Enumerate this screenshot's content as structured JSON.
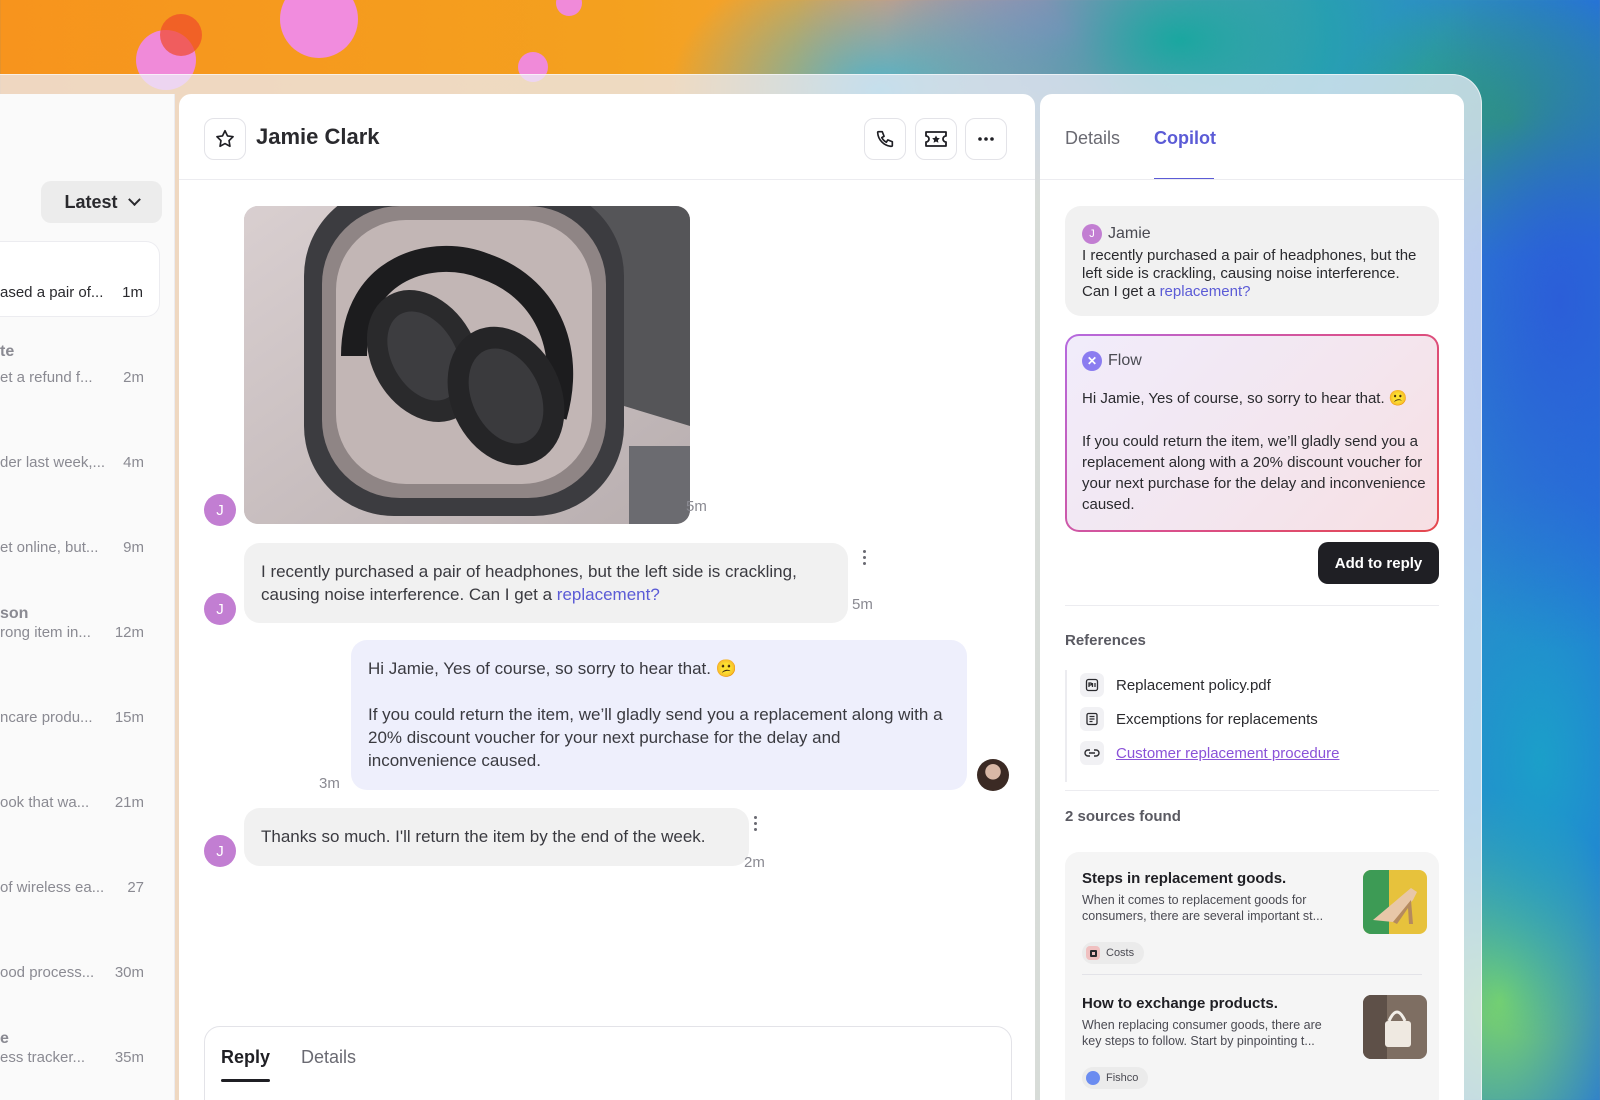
{
  "list": {
    "sort_label": "Latest",
    "items": [
      {
        "name": "",
        "preview": "ased a pair of...",
        "time": "1m",
        "active": true
      },
      {
        "name": "te",
        "preview": "et  a refund f...",
        "time": "2m"
      },
      {
        "name": "",
        "preview": "der last week,...",
        "time": "4m"
      },
      {
        "name": "",
        "preview": "et online, but...",
        "time": "9m"
      },
      {
        "name": "son",
        "preview": "rong item in...",
        "time": "12m"
      },
      {
        "name": "",
        "preview": "ncare produ...",
        "time": "15m"
      },
      {
        "name": "",
        "preview": "ook that wa...",
        "time": "21m"
      },
      {
        "name": "",
        "preview": "of wireless ea...",
        "time": "27"
      },
      {
        "name": "",
        "preview": "ood process...",
        "time": "30m"
      },
      {
        "name": "e",
        "preview": "ess tracker...",
        "time": "35m"
      }
    ]
  },
  "chat": {
    "contact_name": "Jamie Clark",
    "avatar_initial": "J",
    "photo_time": "5m",
    "messages": [
      {
        "from": "customer",
        "text_before": "I recently purchased a pair of headphones, but the left side is crackling, causing noise interference. Can I get a ",
        "link": "replacement?",
        "time": "5m"
      },
      {
        "from": "agent",
        "p1": "Hi Jamie, Yes of course, so sorry to hear that. 😕",
        "p2": "If you could return the item, we’ll gladly send you a replacement along with a 20% discount voucher for your next purchase for the delay and inconvenience caused.",
        "time": "3m"
      },
      {
        "from": "customer",
        "text": "Thanks so much. I'll return the item by the end of the week.",
        "time": "2m"
      }
    ],
    "reply_tabs": [
      "Reply",
      "Details"
    ]
  },
  "copilot": {
    "tabs": [
      "Details",
      "Copilot"
    ],
    "active_tab": "Copilot",
    "user_msg": {
      "initial": "J",
      "name": "Jamie",
      "text_before": "I recently purchased a pair of headphones, but the left side is crackling, causing noise interference. Can I get a ",
      "link": "replacement?"
    },
    "flow": {
      "name": "Flow",
      "p1": "Hi Jamie, Yes of course, so sorry to hear that. 😕",
      "p2": "If you could return the item, we’ll gladly send you a replacement along with a 20% discount voucher for your next purchase for the delay and inconvenience caused."
    },
    "add_to_reply": "Add to reply",
    "references_title": "References",
    "references": [
      {
        "label": "Replacement policy.pdf",
        "icon": "pdf-icon"
      },
      {
        "label": "Excemptions for replacements",
        "icon": "document-icon"
      },
      {
        "label": "Customer replacement procedure",
        "icon": "link-icon",
        "is_link": true
      }
    ],
    "sources_title": "2 sources found",
    "sources": [
      {
        "title": "Steps in replacement goods.",
        "desc": "When it comes to replacement goods for consumers, there are several important st...",
        "tag": "Costs",
        "thumb": "high-heel-shoe-image"
      },
      {
        "title": "How to exchange products.",
        "desc": "When replacing consumer goods, there are key steps to follow. Start by pinpointing t...",
        "tag": "Fishco",
        "thumb": "handbag-image"
      }
    ]
  },
  "colors": {
    "accent": "#5b5bd6",
    "avatar": "#c27ed2",
    "agent_bubble": "#eeeffc",
    "customer_bubble": "#f1f1f1",
    "dark_button": "#1f1f24"
  }
}
